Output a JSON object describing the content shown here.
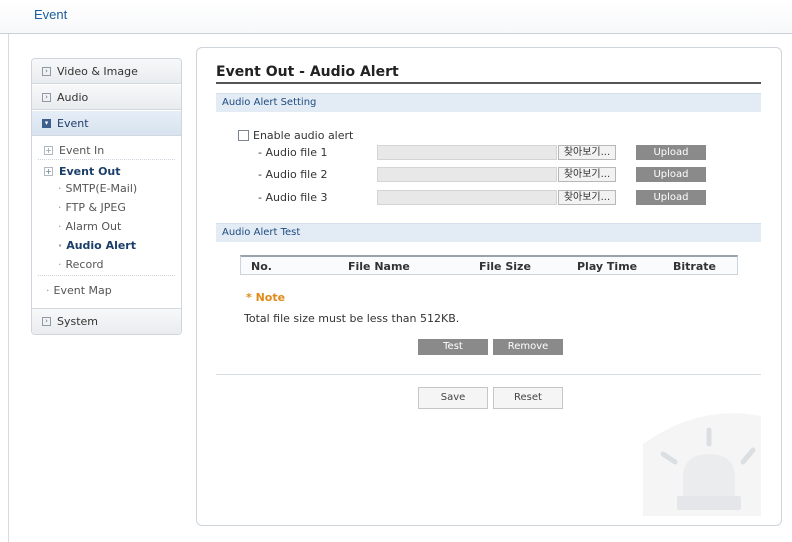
{
  "header": {
    "title": "Event"
  },
  "sidebar": {
    "main_items": [
      {
        "label": "Video & Image"
      },
      {
        "label": "Audio"
      },
      {
        "label": "Event"
      },
      {
        "label": "System"
      }
    ],
    "event_in": "Event In",
    "event_out": "Event Out",
    "event_out_items": [
      {
        "label": "SMTP(E-Mail)"
      },
      {
        "label": "FTP & JPEG"
      },
      {
        "label": "Alarm Out"
      },
      {
        "label": "Audio Alert"
      },
      {
        "label": "Record"
      }
    ],
    "event_map": "Event Map"
  },
  "main": {
    "title": "Event Out - Audio Alert",
    "setting_section": "Audio Alert Setting",
    "enable_label": "Enable audio alert",
    "enable_checked": false,
    "files": [
      {
        "label": "- Audio file 1",
        "browse": "찾아보기...",
        "upload": "Upload"
      },
      {
        "label": "- Audio file 2",
        "browse": "찾아보기...",
        "upload": "Upload"
      },
      {
        "label": "- Audio file 3",
        "browse": "찾아보기...",
        "upload": "Upload"
      }
    ],
    "test_section": "Audio Alert Test",
    "table_headers": [
      "No.",
      "File Name",
      "File Size",
      "Play Time",
      "Bitrate"
    ],
    "note_title": "* Note",
    "note_text": "Total file size must be less than 512KB.",
    "test_button": "Test",
    "remove_button": "Remove",
    "save_button": "Save",
    "reset_button": "Reset"
  },
  "colors": {
    "accent": "#1a5c9c",
    "section_bg": "#e3ebf5",
    "note": "#e08a1a",
    "button_gray": "#8a8a8a"
  }
}
